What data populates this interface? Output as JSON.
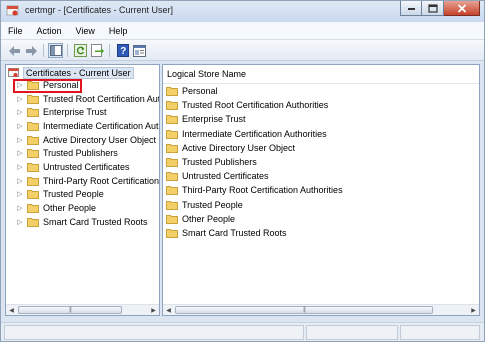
{
  "window": {
    "title": "certmgr - [Certificates - Current User]",
    "buttons": [
      "minimize",
      "maximize",
      "close"
    ]
  },
  "menu": {
    "items": [
      "File",
      "Action",
      "View",
      "Help"
    ]
  },
  "toolbar": {
    "buttons": [
      "back-arrow-icon",
      "forward-arrow-icon",
      "show-hide-console-tree-icon",
      "refresh-icon",
      "export-list-icon",
      "help-icon",
      "properties-icon"
    ]
  },
  "tree": {
    "root_label": "Certificates - Current User",
    "items": [
      {
        "label": "Personal"
      },
      {
        "label": "Trusted Root Certification Authorities"
      },
      {
        "label": "Enterprise Trust"
      },
      {
        "label": "Intermediate Certification Authorities"
      },
      {
        "label": "Active Directory User Object"
      },
      {
        "label": "Trusted Publishers"
      },
      {
        "label": "Untrusted Certificates"
      },
      {
        "label": "Third-Party Root Certification Authorities"
      },
      {
        "label": "Trusted People"
      },
      {
        "label": "Other People"
      },
      {
        "label": "Smart Card Trusted Roots"
      }
    ]
  },
  "stores": {
    "column_header": "Logical Store Name",
    "items": [
      "Personal",
      "Trusted Root Certification Authorities",
      "Enterprise Trust",
      "Intermediate Certification Authorities",
      "Active Directory User Object",
      "Trusted Publishers",
      "Untrusted Certificates",
      "Third-Party Root Certification Authorities",
      "Trusted People",
      "Other People",
      "Smart Card Trusted Roots"
    ]
  },
  "colors": {
    "folder": "#f2cf67",
    "highlight": "#e0141e"
  }
}
